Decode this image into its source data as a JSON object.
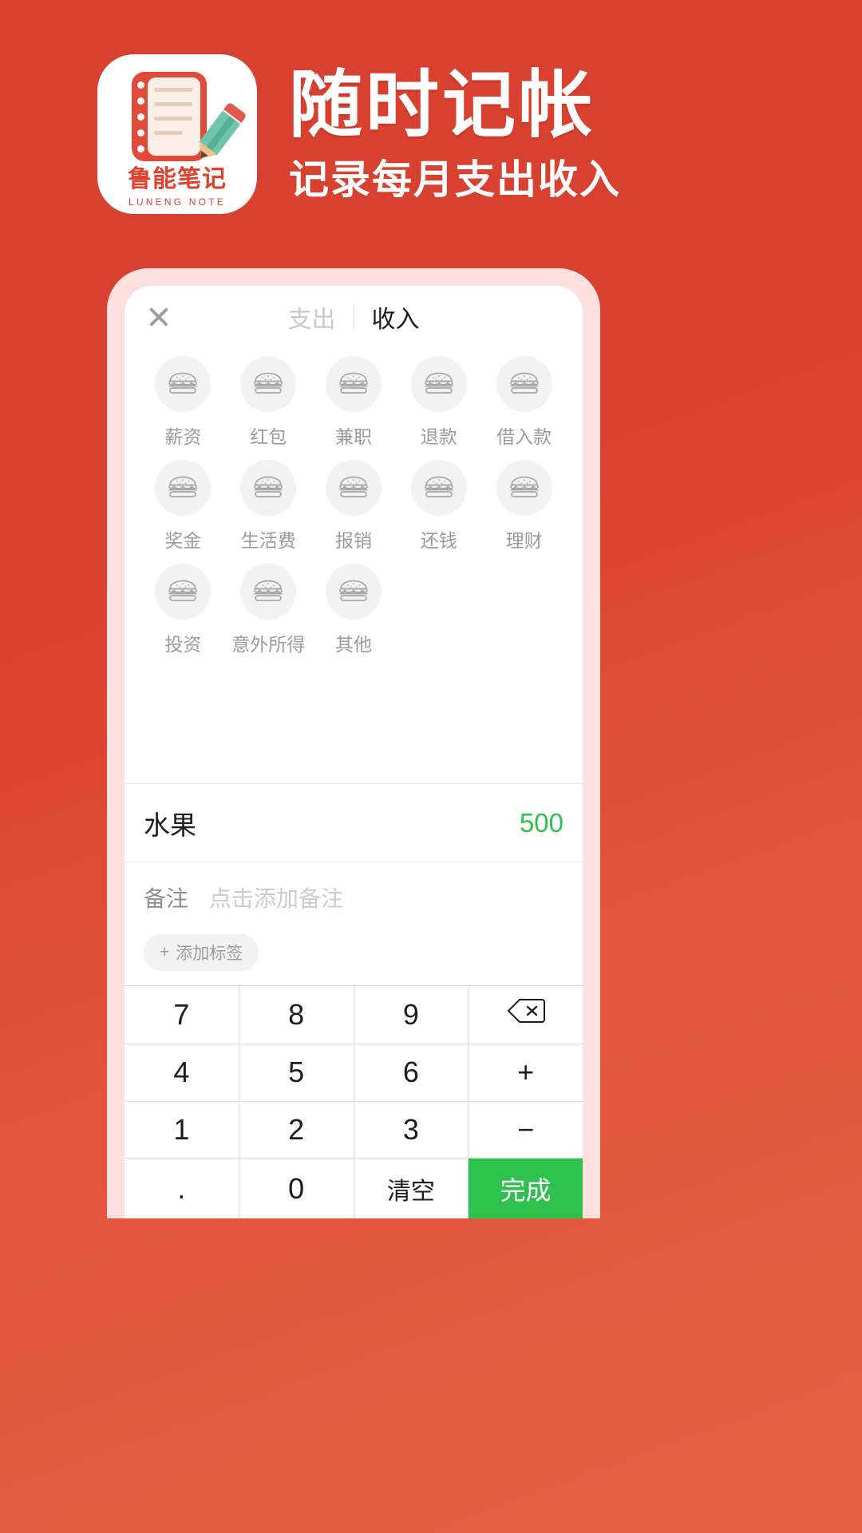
{
  "promo": {
    "brand": {
      "name": "鲁能笔记",
      "subtitle": "LUNENG NOTE"
    },
    "headline": "随时记帐",
    "subheadline": "记录每月支出收入",
    "background_color": "#d8402f",
    "accent_color": "#e0402e"
  },
  "app": {
    "topbar": {
      "close_icon": "close-icon",
      "tabs": [
        {
          "label": "支出",
          "active": false
        },
        {
          "label": "收入",
          "active": true
        }
      ]
    },
    "categories": [
      {
        "label": "薪资",
        "icon": "burger-icon"
      },
      {
        "label": "红包",
        "icon": "burger-icon"
      },
      {
        "label": "兼职",
        "icon": "burger-icon"
      },
      {
        "label": "退款",
        "icon": "burger-icon"
      },
      {
        "label": "借入款",
        "icon": "burger-icon"
      },
      {
        "label": "奖金",
        "icon": "burger-icon"
      },
      {
        "label": "生活费",
        "icon": "burger-icon"
      },
      {
        "label": "报销",
        "icon": "burger-icon"
      },
      {
        "label": "还钱",
        "icon": "burger-icon"
      },
      {
        "label": "理财",
        "icon": "burger-icon"
      },
      {
        "label": "投资",
        "icon": "burger-icon"
      },
      {
        "label": "意外所得",
        "icon": "burger-icon"
      },
      {
        "label": "其他",
        "icon": "burger-icon"
      }
    ],
    "entry": {
      "category_name": "水果",
      "amount": "500",
      "amount_color": "#2ec14e"
    },
    "note": {
      "label": "备注",
      "placeholder": "点击添加备注",
      "value": "",
      "tag_button": "添加标签",
      "tag_plus": "+"
    },
    "keypad": {
      "keys": [
        {
          "label": "7",
          "type": "digit"
        },
        {
          "label": "8",
          "type": "digit"
        },
        {
          "label": "9",
          "type": "digit"
        },
        {
          "label": "",
          "type": "backspace",
          "icon": "backspace-icon"
        },
        {
          "label": "4",
          "type": "digit"
        },
        {
          "label": "5",
          "type": "digit"
        },
        {
          "label": "6",
          "type": "digit"
        },
        {
          "label": "+",
          "type": "operator"
        },
        {
          "label": "1",
          "type": "digit"
        },
        {
          "label": "2",
          "type": "digit"
        },
        {
          "label": "3",
          "type": "digit"
        },
        {
          "label": "−",
          "type": "operator"
        },
        {
          "label": ".",
          "type": "digit"
        },
        {
          "label": "0",
          "type": "digit"
        },
        {
          "label": "清空",
          "type": "clear"
        },
        {
          "label": "完成",
          "type": "done"
        }
      ]
    }
  }
}
